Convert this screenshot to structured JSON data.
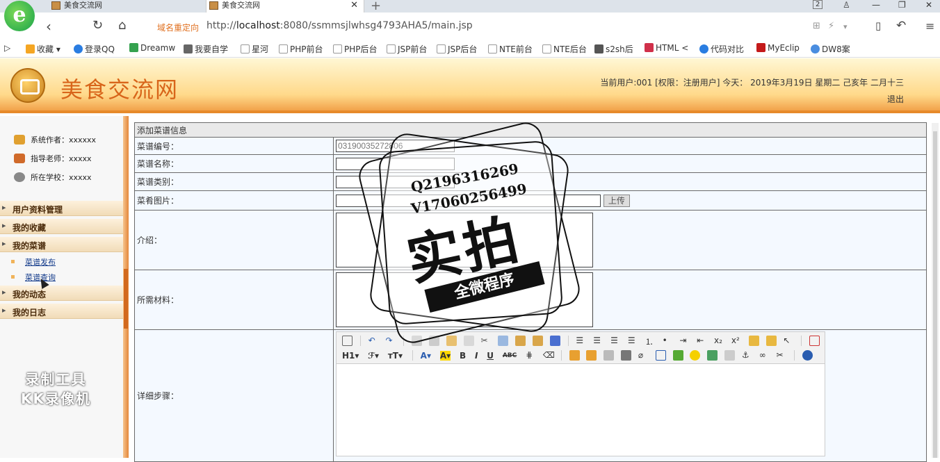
{
  "browser": {
    "tabs": [
      {
        "title": "美食交流网",
        "active": false
      },
      {
        "title": "美食交流网",
        "active": true
      }
    ],
    "logo_letter": "e",
    "tab_count_badge": "2",
    "redirect_label": "域名重定向",
    "url_prefix": "http://",
    "url_host": "localhost",
    "url_rest": ":8080/ssmmsjlwhsg4793AHA5/main.jsp",
    "bookmarks": [
      {
        "label": "收藏",
        "color": "#f5a623"
      },
      {
        "label": "登录QQ",
        "color": "#2a7de1"
      },
      {
        "label": "Dreamw",
        "color": "#35a24f"
      },
      {
        "label": "我要自学",
        "color": "#666666"
      },
      {
        "label": "星河",
        "color": "#999999"
      },
      {
        "label": "PHP前台",
        "color": "#999999"
      },
      {
        "label": "PHP后台",
        "color": "#999999"
      },
      {
        "label": "JSP前台",
        "color": "#999999"
      },
      {
        "label": "JSP后台",
        "color": "#999999"
      },
      {
        "label": "NTE前台",
        "color": "#999999"
      },
      {
        "label": "NTE后台",
        "color": "#999999"
      },
      {
        "label": "s2sh后",
        "color": "#555555"
      },
      {
        "label": "HTML",
        "color": "#d0304a"
      },
      {
        "label": "代码对比",
        "color": "#2a7de1"
      },
      {
        "label": "MyEclip",
        "color": "#c41a1a"
      },
      {
        "label": "DW8案",
        "color": "#4a8de0"
      }
    ]
  },
  "site": {
    "title": "美食交流网",
    "user_info": "当前用户:001 [权限：注册用户] 今天： 2019年3月19日 星期二 己亥年 二月十三",
    "logout": "退出"
  },
  "sidebar": {
    "info": [
      {
        "label": "系统作者：xxxxxx",
        "icon": "user-icon",
        "color": "#e0a030"
      },
      {
        "label": "指导老师：xxxxx",
        "icon": "teacher-icon",
        "color": "#d06a2a"
      },
      {
        "label": "所在学校：xxxxx",
        "icon": "school-icon",
        "color": "#888888"
      }
    ],
    "menus": [
      {
        "label": "用户资料管理"
      },
      {
        "label": "我的收藏"
      },
      {
        "label": "我的菜谱"
      }
    ],
    "submenu": [
      "菜谱发布",
      "菜谱查询"
    ],
    "menus_after": [
      {
        "label": "我的动态"
      },
      {
        "label": "我的日志"
      }
    ],
    "recorder_watermark_line1": "录制工具",
    "recorder_watermark_line2": "KK录像机"
  },
  "form": {
    "caption": "添加菜谱信息",
    "fields": {
      "code_label": "菜谱编号：",
      "code_value": "03190035272806",
      "name_label": "菜谱名称：",
      "category_label": "菜谱类别：",
      "image_label": "菜肴图片：",
      "upload_button": "上传",
      "intro_label": "介绍：",
      "materials_label": "所需材料：",
      "steps_label": "详细步骤："
    },
    "editor_toolbar": {
      "heading": "H1",
      "font_family": "ℱ",
      "font_size": "ᴛT",
      "font_color": "A",
      "highlight": "A",
      "bold": "B",
      "italic": "I",
      "underline": "U",
      "strike": "ABC"
    }
  },
  "stamp": {
    "qq": "Q2196316269",
    "vx": "V17060256499",
    "big": "实拍",
    "banner": "全微程序"
  }
}
